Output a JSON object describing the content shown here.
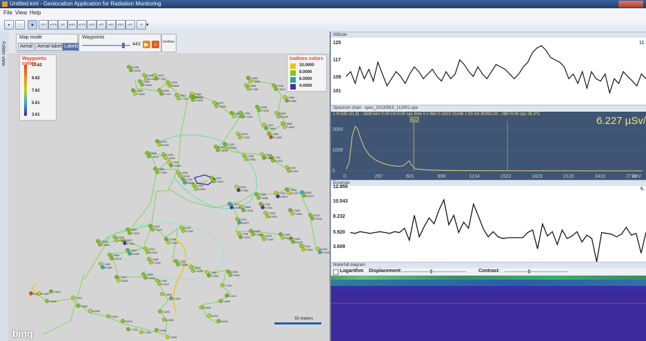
{
  "window": {
    "title": "Untitled.kml - Geolocation Application for Radiation Monitoring"
  },
  "menu": [
    "File",
    "View",
    "Help"
  ],
  "toolbar": {
    "buttons": [
      "CPS",
      "nCPS",
      "DR",
      "nREL",
      "nCPS",
      "nDR",
      "nRT",
      "nRS",
      "nREL",
      "nRT"
    ]
  },
  "sidebar": {
    "folder_view": "Folder view"
  },
  "map_mode": {
    "label": "Map mode",
    "options": [
      "Aerial",
      "Aerial-labels",
      "Labels"
    ],
    "selected": "Labels"
  },
  "waypoints": {
    "label": "Waypoints",
    "count": "443",
    "slider_level": 0.88
  },
  "isolines_label": "Isolines",
  "waypoint_colors": {
    "title": "Waypoints colors",
    "stops": [
      {
        "value": "11.62",
        "color": "#e8411c"
      },
      {
        "value": "9.62",
        "color": "#f08a1a"
      },
      {
        "value": "7.62",
        "color": "#b7d91d"
      },
      {
        "value": "5.61",
        "color": "#2fa6d8"
      },
      {
        "value": "3.61",
        "color": "#4a1fa5"
      }
    ]
  },
  "isolines_colors": {
    "title": "Isolines colors",
    "items": [
      {
        "value": "10.0000",
        "color": "#f2c211"
      },
      {
        "value": "8.0000",
        "color": "#86c41d"
      },
      {
        "value": "6.0000",
        "color": "#2fa28e"
      },
      {
        "value": "4.0000",
        "color": "#4a2fb0"
      }
    ]
  },
  "map": {
    "labels": [
      "8.0138",
      "8.0606",
      "7.9037",
      "7.9259",
      "7.9916",
      "7.8894",
      "8.0328",
      "7.8817",
      "7.7003",
      "7.7007",
      "8.0277",
      "7.9905",
      "8.7045",
      "7.6095",
      "7.2965",
      "7.5408",
      "8.0401",
      "7.8625",
      "7.7500",
      "7.6960",
      "7.2417",
      "7.9262",
      "7.6279",
      "7.7125",
      "8.0260",
      "7.7400",
      "7.5404",
      "7.7700",
      "8.3107",
      "8.2014",
      "8.3033",
      "8.1240",
      "7.7120",
      "7.0807",
      "7.4418",
      "7.7700",
      "7.2413",
      "7.2400",
      "8.0010",
      "7.7400",
      "7.7516",
      "7.8414",
      "6.6620",
      "6.4673",
      "7.8009",
      "8.7203",
      "7.7036",
      "7.7400",
      "7.5412",
      "8.0112",
      "7.7406",
      "8.0063",
      "7.6073",
      "7.9400",
      "7.0201",
      "7.9111",
      "8.0401",
      "7.2413",
      "8.0119",
      "7.0306",
      "7.6037",
      "8.0076",
      "7.6011",
      "7.5100",
      "7.8113",
      "7.6017",
      "7.3906",
      "7.5409",
      "7.7620",
      "7.7100",
      "7.8413",
      "7.7270",
      "7.8830",
      "8.7008",
      "7.7600",
      "8.2040",
      "7.7100",
      "8.1410",
      "7.8000",
      "6.9316",
      "8.0211",
      "8.6011",
      "7.6008",
      "7.1000",
      "7.4100",
      "8.2000",
      "7.2201",
      "7.6404",
      "7.7400",
      "7.7002",
      "8.0074",
      "7.9100",
      "8.0400",
      "7.2400",
      "7.3117",
      "7.9201",
      "7.0418",
      "11.6202",
      "7.4100",
      "7.8130",
      "8.1400",
      "7.7022",
      "7.5940",
      "6.9820",
      "7.6040",
      "8.7110",
      "7.7112",
      "8.0408",
      "7.6400",
      "7.6032",
      "7.0400",
      "7.8113",
      "6.7108",
      "8.4006",
      "7.0200",
      "8.1400",
      "7.7031",
      "7.1138",
      "7.8403",
      "7.5901",
      "11.4020",
      "7.7000",
      "8.6110",
      "7.6040",
      "7.2801",
      "7.7610",
      "8.1010",
      "8.1001",
      "8.1100",
      "7.8015",
      "7.6100",
      "7.6450",
      "7.7900",
      "7.9418",
      "6.6150",
      "7.6010",
      "8.3032",
      "4.7009",
      "7.6460",
      "4.5070",
      "8.7122",
      "8.9374",
      "4.9130",
      "7.2216",
      "4.7031",
      "8.0023",
      "7.2900",
      "7.5040",
      "6.6072",
      "7.3270",
      "7.2940",
      "7.0041",
      "7.9100",
      "8.7124",
      "7.8041",
      "5.9120",
      "7.2419",
      "6.7040",
      "7.4100",
      "7.2413",
      "7.2004",
      "4.7813",
      "7.4004",
      "8.2100",
      "6.6155",
      "7.6019",
      "7.2100",
      "6.0900",
      "7.8106",
      "7.6200",
      "7.8402",
      "7.2000",
      "7.0013",
      "7.9302",
      "7.9001"
    ],
    "scale_label": "50 meters",
    "brand": "bing"
  },
  "altitude": {
    "title": "Altitude",
    "ticks": [
      "125",
      "117",
      "109",
      "101"
    ],
    "right_label": "11",
    "values": [
      111,
      113,
      108,
      115,
      110,
      114,
      109,
      117,
      112,
      107,
      110,
      113,
      111,
      108,
      112,
      115,
      113,
      110,
      112,
      114,
      111,
      109,
      113,
      110,
      112,
      118,
      116,
      113,
      111,
      115,
      112,
      110,
      113,
      116,
      115,
      114,
      112,
      110,
      112,
      115,
      117,
      121,
      123,
      124,
      122,
      119,
      118,
      117,
      115,
      110,
      112,
      108,
      113,
      106,
      113,
      110,
      109,
      112,
      104,
      110,
      108,
      113,
      111,
      109,
      107,
      112,
      110
    ]
  },
  "spectrum": {
    "title": "Spectrum chart - spec_20130919_112001.spe",
    "info": "1 N 535 (11.8) - 1628 keV  0.00 cnt 0.00 cps  time 5 s   Win 0-1023 15146 1.00 cnt 30292.20 - 28074.00 cps  26.3°C",
    "marker": "662",
    "dose": "6.227 µSv/",
    "yticks": [
      "2000",
      "1000",
      "0"
    ],
    "xticks": [
      "0",
      "297",
      "601",
      "908",
      "1214",
      "1522",
      "1823",
      "2120",
      "2415",
      "2710",
      "keV"
    ],
    "xmax": 2900,
    "ymax": 2400,
    "curve": [
      [
        0,
        80
      ],
      [
        30,
        400
      ],
      [
        60,
        1700
      ],
      [
        90,
        2150
      ],
      [
        110,
        2050
      ],
      [
        140,
        1600
      ],
      [
        180,
        1100
      ],
      [
        230,
        750
      ],
      [
        290,
        520
      ],
      [
        350,
        380
      ],
      [
        420,
        280
      ],
      [
        500,
        220
      ],
      [
        560,
        240
      ],
      [
        600,
        420
      ],
      [
        620,
        480
      ],
      [
        640,
        280
      ],
      [
        680,
        90
      ],
      [
        800,
        40
      ],
      [
        1000,
        15
      ],
      [
        1400,
        5
      ],
      [
        2900,
        0
      ]
    ]
  },
  "doserate": {
    "title": "Doserate",
    "ticks": [
      "12.855",
      "10.543",
      "8.232",
      "5.920",
      "3.609"
    ],
    "right_label": "6.",
    "values": [
      7.5,
      7.4,
      7.6,
      7.5,
      7.4,
      7.5,
      7.6,
      7.5,
      7.4,
      7.6,
      7.5,
      8.0,
      6.6,
      9.5,
      7.0,
      8.2,
      9.2,
      8.5,
      10.1,
      11.3,
      8.4,
      9.5,
      7.5,
      8.7,
      8.0,
      10.8,
      9.4,
      7.9,
      7.0,
      7.6,
      7.0,
      6.8,
      6.9,
      6.9,
      6.9,
      6.9,
      7.5,
      7.8,
      5.6,
      8.5,
      7.1,
      7.6,
      6.1,
      7.8,
      6.8,
      7.1,
      7.6,
      6.4,
      7.2,
      6.8,
      4.1,
      7.5,
      7.4,
      7.3,
      7.0,
      7.3,
      8.1,
      7.2,
      7.4,
      5.1,
      7.5
    ]
  },
  "waterfall": {
    "title": "Waterfall diagram",
    "logarithm_label": "Logarithm",
    "displacement_label": "Displacement:",
    "contrast_label": "Contrast:"
  }
}
